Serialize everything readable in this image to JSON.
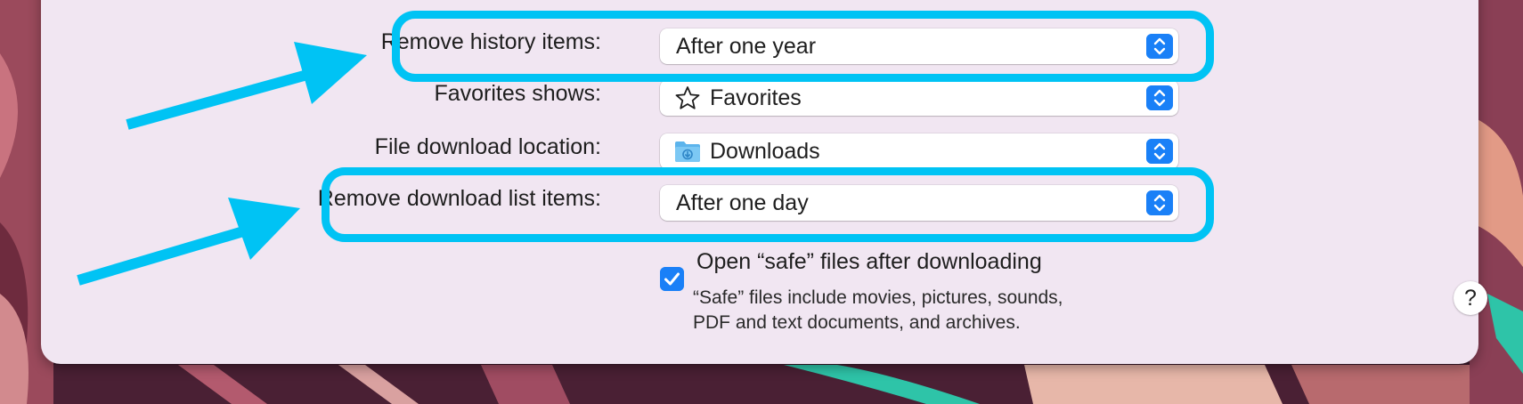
{
  "colors": {
    "panel_bg": "#f1e6f2",
    "accent_blue": "#1a80f7",
    "annotation_cyan": "#00c3f4",
    "wallpaper_dark": "#3c1a2b",
    "wallpaper_pink": "#b35a6e",
    "wallpaper_teal": "#2ec4a8"
  },
  "settings": {
    "rows": [
      {
        "label": "Remove history items:",
        "value": "After one year",
        "icon": null
      },
      {
        "label": "Favorites shows:",
        "value": "Favorites",
        "icon": "star-outline-icon"
      },
      {
        "label": "File download location:",
        "value": "Downloads",
        "icon": "downloads-folder-icon"
      },
      {
        "label": "Remove download list items:",
        "value": "After one day",
        "icon": null
      }
    ],
    "stepper_icon": "up-down-chevron-icon"
  },
  "safe_files": {
    "checked": true,
    "label": "Open “safe” files after downloading",
    "help_line1": "“Safe” files include movies, pictures, sounds,",
    "help_line2": "PDF and text documents, and archives."
  },
  "help_button": {
    "label": "?"
  },
  "annotations": {
    "highlighted_rows": [
      "Remove history items:",
      "Remove download list items:"
    ],
    "arrow_icon": "arrow-right-icon"
  }
}
